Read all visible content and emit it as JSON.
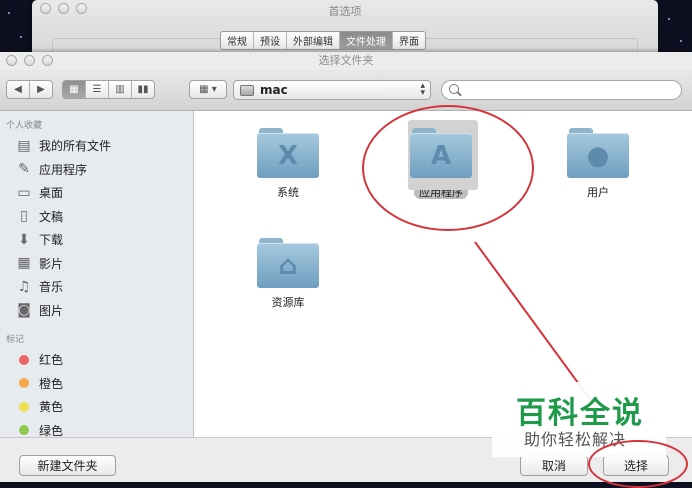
{
  "prefs_window": {
    "title": "首选项",
    "tabs": [
      {
        "label": "常规",
        "selected": false
      },
      {
        "label": "预设",
        "selected": false
      },
      {
        "label": "外部编辑",
        "selected": false
      },
      {
        "label": "文件处理",
        "selected": true
      },
      {
        "label": "界面",
        "selected": false
      }
    ]
  },
  "dialog": {
    "title": "选择文件夹",
    "nav_back_icon": "chevron-left-icon",
    "nav_forward_icon": "chevron-right-icon",
    "view_modes": [
      "icon-view",
      "list-view",
      "column-view",
      "coverflow-view"
    ],
    "selected_view": "icon-view",
    "arrange_icon": "grid-arrange-icon",
    "path_popup": {
      "value": "mac"
    },
    "search": {
      "placeholder": ""
    }
  },
  "sidebar": {
    "sections": [
      {
        "header": "个人收藏",
        "items": [
          {
            "label": "我的所有文件",
            "icon": "all-files-icon",
            "glyph": "▤"
          },
          {
            "label": "应用程序",
            "icon": "applications-icon",
            "glyph": "✎"
          },
          {
            "label": "桌面",
            "icon": "desktop-icon",
            "glyph": "▭"
          },
          {
            "label": "文稿",
            "icon": "documents-icon",
            "glyph": "▯"
          },
          {
            "label": "下载",
            "icon": "download-icon",
            "glyph": "⬇"
          },
          {
            "label": "影片",
            "icon": "movies-icon",
            "glyph": "▦"
          },
          {
            "label": "音乐",
            "icon": "music-icon",
            "glyph": "♫"
          },
          {
            "label": "图片",
            "icon": "pictures-icon",
            "glyph": "◙"
          }
        ]
      },
      {
        "header": "标记",
        "items": [
          {
            "label": "红色",
            "color": "#e96567"
          },
          {
            "label": "橙色",
            "color": "#f4a94a"
          },
          {
            "label": "黄色",
            "color": "#f1e04f"
          },
          {
            "label": "绿色",
            "color": "#8ecb4a"
          }
        ]
      }
    ]
  },
  "files": [
    {
      "label": "系统",
      "icon": "folder-system-icon",
      "glyph": "X",
      "selected": false
    },
    {
      "label": "应用程序",
      "icon": "folder-applications-icon",
      "glyph": "A",
      "selected": true
    },
    {
      "label": "用户",
      "icon": "folder-users-icon",
      "glyph": "●",
      "selected": false
    },
    {
      "label": "资源库",
      "icon": "folder-library-icon",
      "glyph": "⌂",
      "selected": false
    }
  ],
  "buttons": {
    "new_folder": "新建文件夹",
    "cancel": "取消",
    "choose": "选择"
  },
  "watermark": {
    "title": "百科全说",
    "subtitle": "助你轻松解决",
    "color": "#1e9a4a"
  },
  "annotation_color": "#d6333b"
}
